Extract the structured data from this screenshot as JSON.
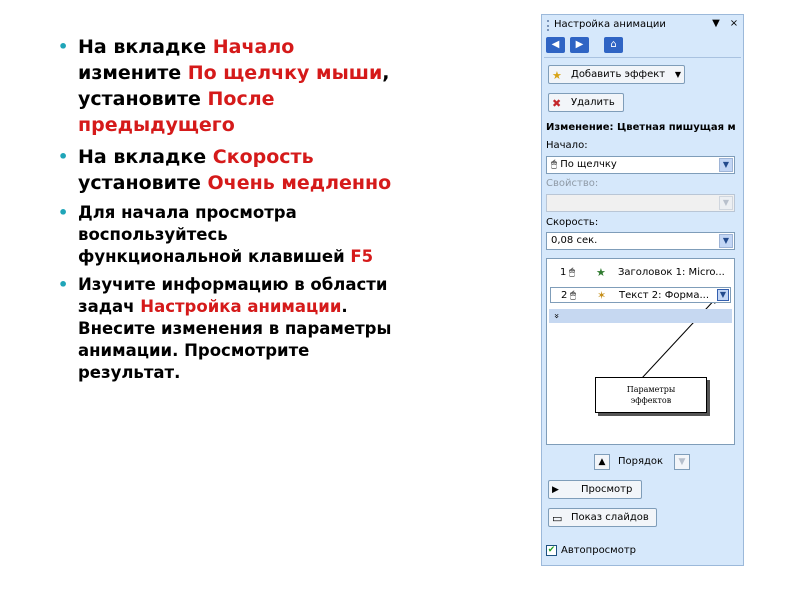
{
  "slide": {
    "bullets": [
      {
        "size": "large",
        "parts": [
          {
            "t": "На вкладке "
          },
          {
            "t": "Начало",
            "hl": true
          },
          {
            "t": " измените "
          },
          {
            "t": "По щелчку мыши",
            "hl": true
          },
          {
            "t": ", установите "
          },
          {
            "t": "После предыдущего",
            "hl": true
          }
        ]
      },
      {
        "size": "large",
        "parts": [
          {
            "t": "На вкладке "
          },
          {
            "t": "Скорость",
            "hl": true
          },
          {
            "t": " установите "
          },
          {
            "t": "Очень медленно",
            "hl": true
          }
        ]
      },
      {
        "size": "small",
        "parts": [
          {
            "t": "Для начала просмотра воспользуйтесь функциональной клавишей "
          },
          {
            "t": "F5",
            "hl": true
          }
        ]
      },
      {
        "size": "small",
        "parts": [
          {
            "t": "Изучите информацию в области задач "
          },
          {
            "t": "Настройка анимации",
            "hl": true
          },
          {
            "t": ". Внесите изменения в параметры анимации. Просмотрите результат."
          }
        ]
      }
    ]
  },
  "pane": {
    "title": "Настройка анимации",
    "dropdown_glyph": "▼",
    "close_glyph": "×",
    "nav": {
      "back": "◀",
      "forward": "▶",
      "home": "⌂"
    },
    "add_effect": {
      "icon": "★",
      "label": "Добавить эффект",
      "arrow": "▼"
    },
    "delete": {
      "icon": "✖",
      "label": "Удалить"
    },
    "change_label": "Изменение: Цветная пишущая м",
    "start": {
      "label": "Начало:",
      "value": "По щелчку",
      "icon": "🖱"
    },
    "property": {
      "label": "Свойство:",
      "value": ""
    },
    "speed": {
      "label": "Скорость:",
      "value": "0,08 сек."
    },
    "list": [
      {
        "num": "1",
        "mouse": "🖱",
        "star": "★",
        "text": "Заголовок 1: Micro..."
      },
      {
        "num": "2",
        "mouse": "🖱",
        "star": "✶",
        "text": "Текст 2: Форма..."
      }
    ],
    "expand_glyph": "»",
    "callout": {
      "line1": "Параметры",
      "line2": "эффектов"
    },
    "order": {
      "up": "▲",
      "label": "Порядок",
      "down": "▼"
    },
    "preview": {
      "icon": "▶",
      "label": "Просмотр"
    },
    "slideshow": {
      "icon": "▭",
      "label": "Показ слайдов"
    },
    "autopreview": {
      "label": "Автопросмотр",
      "checked": true,
      "check_glyph": "✔"
    },
    "colors": {
      "accent": "#d51a1a",
      "pane_bg": "#d6e8fb",
      "nav_blue": "#2f64c4"
    }
  }
}
